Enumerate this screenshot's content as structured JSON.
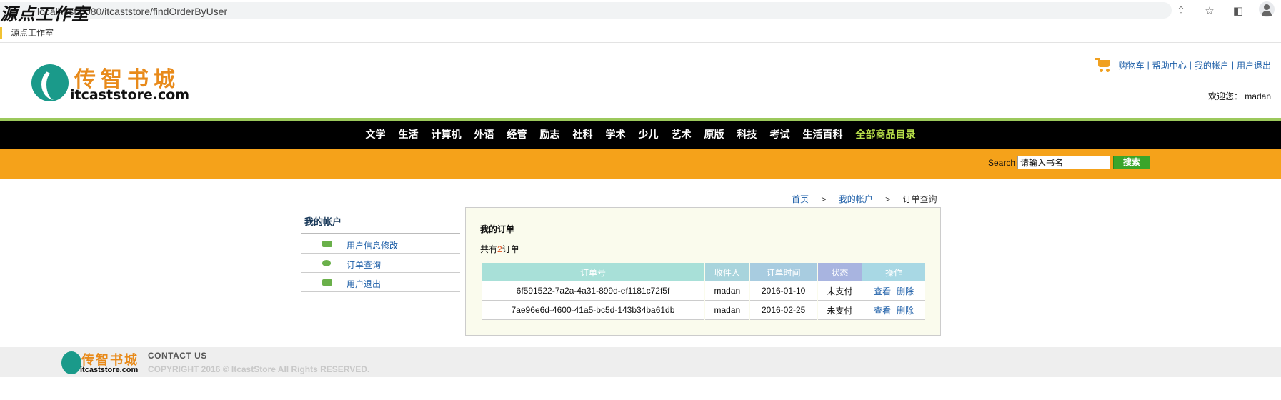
{
  "browser": {
    "url": "localhost:8080/itcaststore/findOrderByUser",
    "watermark": "源点工作室",
    "bookmark": "源点工作室"
  },
  "header": {
    "logo_cn": "传智书城",
    "logo_en": "itcaststore.com",
    "links": {
      "cart": "购物车",
      "help": "帮助中心",
      "account": "我的帐户",
      "logout": "用户退出",
      "separator": "|"
    },
    "welcome": "欢迎您：  madan"
  },
  "nav": {
    "items": [
      "文学",
      "生活",
      "计算机",
      "外语",
      "经管",
      "励志",
      "社科",
      "学术",
      "少儿",
      "艺术",
      "原版",
      "科技",
      "考试",
      "生活百科"
    ],
    "all_label": "全部商品目录"
  },
  "search": {
    "label": "Search",
    "value": "请输入书名",
    "button": "搜索"
  },
  "breadcrumb": {
    "home": "首页",
    "account": "我的帐户",
    "current": "订单查询",
    "sep": ">"
  },
  "sidebar": {
    "title": "我的帐户",
    "items": [
      "用户信息修改",
      "订单查询",
      "用户退出"
    ]
  },
  "orders": {
    "title": "我的订单",
    "count_prefix": "共有",
    "count": "2",
    "count_suffix": "订单",
    "columns": [
      "订单号",
      "收件人",
      "订单时间",
      "状态",
      "操作"
    ],
    "rows": [
      {
        "id": "6f591522-7a2a-4a31-899d-ef1181c72f5f",
        "receiver": "madan",
        "time": "2016-01-10",
        "status": "未支付",
        "view": "查看",
        "delete": "删除"
      },
      {
        "id": "7ae96e6d-4600-41a5-bc5d-143b34ba61db",
        "receiver": "madan",
        "time": "2016-02-25",
        "status": "未支付",
        "view": "查看",
        "delete": "删除"
      }
    ]
  },
  "footer": {
    "logo_cn": "传智书城",
    "logo_en": "itcaststore.com",
    "contact": "CONTACT US",
    "copyright": "COPYRIGHT 2016 © ItcastStore All Rights RESERVED."
  }
}
